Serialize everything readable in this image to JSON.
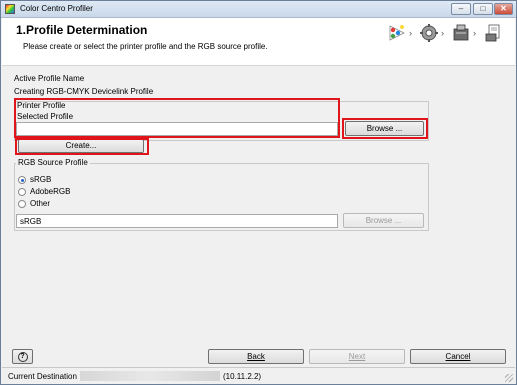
{
  "window": {
    "title": "Color Centro Profiler",
    "controls": {
      "minimize": "–",
      "maximize": "□",
      "close": "✕"
    }
  },
  "header": {
    "title": "1.Profile Determination",
    "subtitle": "Please create or select the printer profile and the RGB source profile.",
    "step_icons": [
      "rgb-color-icon",
      "gear-icon",
      "printer-icon",
      "document-output-icon"
    ]
  },
  "active_profile": {
    "label": "Active Profile Name",
    "value": "Creating RGB-CMYK Devicelink Profile"
  },
  "printer_profile": {
    "group_label": "Printer Profile",
    "selected_label": "Selected Profile",
    "selected_value": "",
    "browse_label": "Browse ...",
    "create_label": "Create..."
  },
  "rgb_source": {
    "group_label": "RGB Source Profile",
    "options": [
      "sRGB",
      "AdobeRGB",
      "Other"
    ],
    "selected_option": "sRGB",
    "path_value": "sRGB",
    "browse_label": "Browse ..."
  },
  "footer": {
    "help_label": "?",
    "back_label": "Back",
    "next_label": "Next",
    "cancel_label": "Cancel"
  },
  "status": {
    "label": "Current Destination",
    "value": "(10.11.2.2)"
  },
  "colors": {
    "annotation": "#e0141b",
    "radio_accent": "#1e62c8"
  }
}
